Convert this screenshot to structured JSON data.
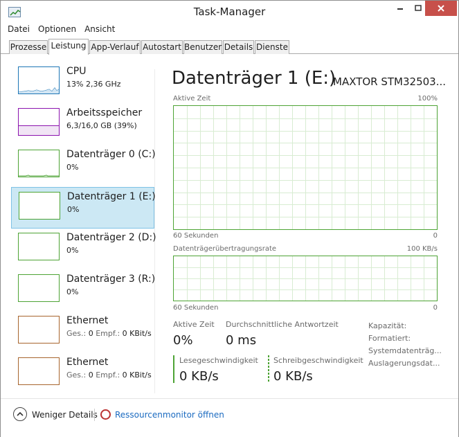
{
  "window": {
    "title": "Task-Manager"
  },
  "menu": [
    "Datei",
    "Optionen",
    "Ansicht"
  ],
  "tabs": [
    "Prozesse",
    "Leistung",
    "App-Verlauf",
    "Autostart",
    "Benutzer",
    "Details",
    "Dienste"
  ],
  "active_tab": "Leistung",
  "sidebar": [
    {
      "name": "CPU",
      "sub": "13%  2,36 GHz",
      "color": "#1c75b5",
      "fill": 0.13
    },
    {
      "name": "Arbeitsspeicher",
      "sub": "6,3/16,0 GB (39%)",
      "color": "#8b12ae",
      "fill": 0.39
    },
    {
      "name": "Datenträger 0 (C:)",
      "sub": "0%",
      "color": "#4da334",
      "fill": 0
    },
    {
      "name": "Datenträger 1 (E:)",
      "sub": "0%",
      "color": "#4da334",
      "fill": 0,
      "selected": true
    },
    {
      "name": "Datenträger 2 (D:)",
      "sub": "0%",
      "color": "#4da334",
      "fill": 0
    },
    {
      "name": "Datenträger 3 (R:)",
      "sub": "0%",
      "color": "#4da334",
      "fill": 0
    },
    {
      "name": "Ethernet",
      "sub_prefix": "Ges.:",
      "sub_a": "0",
      "sub_mid": "Empf.:",
      "sub_b": "0 KBit/s",
      "color": "#a7642c",
      "fill": 0
    },
    {
      "name": "Ethernet",
      "sub_prefix": "Ges.:",
      "sub_a": "0",
      "sub_mid": "Empf.:",
      "sub_b": "0 KBit/s",
      "color": "#a7642c",
      "fill": 0
    }
  ],
  "detail": {
    "title": "Datenträger 1 (E:)",
    "model": "MAXTOR STM32503...",
    "graph1": {
      "label": "Aktive Zeit",
      "max": "100%",
      "time": "60 Sekunden",
      "min": "0"
    },
    "graph2": {
      "label": "Datenträgerübertragungsrate",
      "max": "100 KB/s",
      "time": "60 Sekunden",
      "min": "0"
    },
    "stats": {
      "active_label": "Aktive Zeit",
      "active_value": "0%",
      "response_label": "Durchschnittliche Antwortzeit",
      "response_value": "0 ms",
      "read_label": "Lesegeschwindigkeit",
      "read_value": "0 KB/s",
      "write_label": "Schreibgeschwindigkeit",
      "write_value": "0 KB/s"
    },
    "props": [
      "Kapazität:",
      "Formatiert:",
      "Systemdatenträg...",
      "Auslagerungsdat..."
    ]
  },
  "footer": {
    "fewer": "Weniger Details",
    "resmon": "Ressourcenmonitor öffnen"
  }
}
